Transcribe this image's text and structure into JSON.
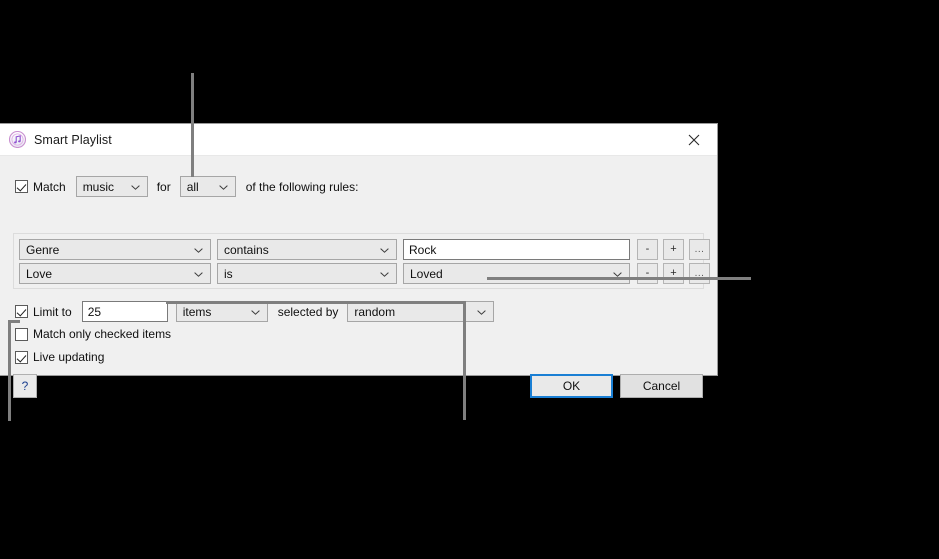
{
  "window": {
    "title": "Smart Playlist",
    "icon": "itunes-music-note-icon",
    "close_label": "✕"
  },
  "match_row": {
    "match_checked": true,
    "match_label": "Match",
    "media_kind": "music",
    "for_label": "for",
    "match_mode": "all",
    "suffix_label": "of the following rules:"
  },
  "rules": [
    {
      "field": "Genre",
      "operator": "contains",
      "value": "Rock",
      "value_type": "text",
      "remove_label": "-",
      "add_label": "+",
      "more_label": "..."
    },
    {
      "field": "Love",
      "operator": "is",
      "value": "Loved",
      "value_type": "combo",
      "remove_label": "-",
      "add_label": "+",
      "more_label": "..."
    }
  ],
  "limit_row": {
    "limit_checked": true,
    "limit_label": "Limit to",
    "limit_value": "25",
    "limit_unit": "items",
    "selected_by_label": "selected by",
    "selected_by_value": "random"
  },
  "options": {
    "match_only_checked": false,
    "match_only_checked_label": "Match only checked items",
    "live_updating": true,
    "live_updating_label": "Live updating"
  },
  "footer": {
    "help_label": "?",
    "ok_label": "OK",
    "cancel_label": "Cancel"
  },
  "colors": {
    "accent": "#1a7fd4",
    "dialog_bg": "#f0f0f0",
    "leader_line": "#7f7f7f",
    "page_bg": "#000000"
  }
}
